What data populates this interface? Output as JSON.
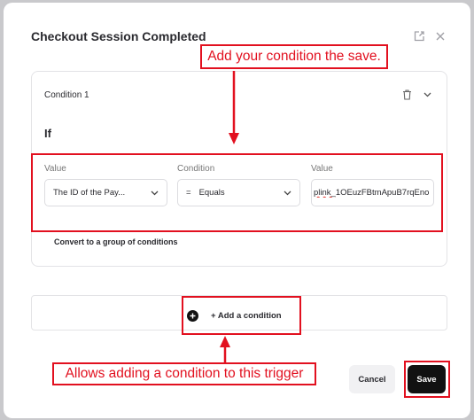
{
  "modal": {
    "title": "Checkout Session Completed",
    "icons": [
      "external-link-icon",
      "close-icon"
    ]
  },
  "condition": {
    "title": "Condition 1",
    "if_label": "If",
    "fields": {
      "value_label": "Value",
      "value_selected": "The ID of the Pay...",
      "condition_label": "Condition",
      "condition_symbol": "=",
      "condition_selected": "Equals",
      "compare_label": "Value",
      "compare_prefix": "plink_",
      "compare_rest": "1OEuzFBtmApuB7rqEno"
    },
    "convert_link": "Convert to a group of conditions"
  },
  "add_condition": {
    "label": "+ Add a condition"
  },
  "footer": {
    "cancel": "Cancel",
    "save": "Save"
  },
  "annotations": {
    "top": "Add your condition the save.",
    "bottom": "Allows adding a condition to this trigger"
  },
  "colors": {
    "annotation": "#e2101f",
    "save_bg": "#111111"
  }
}
